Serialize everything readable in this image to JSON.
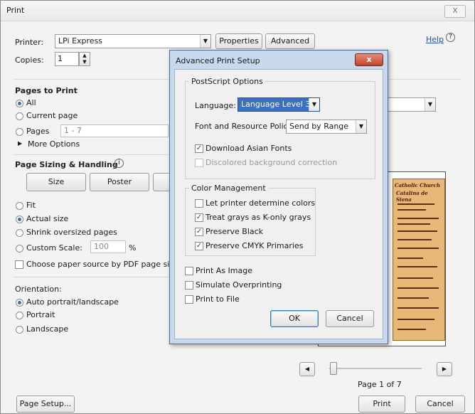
{
  "window": {
    "title": "Print",
    "close_label": "X"
  },
  "header": {
    "printer_label": "Printer:",
    "printer_value": "LPi Express",
    "properties_label": "Properties",
    "advanced_label": "Advanced",
    "help_label": "Help",
    "copies_label": "Copies:",
    "copies_value": "1"
  },
  "pages_to_print": {
    "heading": "Pages to Print",
    "all": "All",
    "current": "Current page",
    "pages": "Pages",
    "pages_value": "1 - 7",
    "more_options": "More Options"
  },
  "sizing": {
    "heading": "Page Sizing & Handling",
    "size_tab": "Size",
    "poster_tab": "Poster",
    "fit": "Fit",
    "actual": "Actual size",
    "shrink": "Shrink oversized pages",
    "custom": "Custom Scale:",
    "custom_value": "100",
    "percent": "%",
    "paper_source": "Choose paper source by PDF page size"
  },
  "orientation": {
    "heading": "Orientation:",
    "auto": "Auto portrait/landscape",
    "portrait": "Portrait",
    "landscape": "Landscape"
  },
  "preview": {
    "page_of": "Page 1 of 7",
    "title1": "Catholic Church",
    "title2": "Catalina de Siena"
  },
  "footer": {
    "page_setup": "Page Setup...",
    "print": "Print",
    "cancel": "Cancel"
  },
  "advanced_dialog": {
    "title": "Advanced Print Setup",
    "postscript_heading": "PostScript Options",
    "language_label": "Language:",
    "language_value": "Language Level 3",
    "font_policy_label": "Font and Resource Policy:",
    "font_policy_value": "Send by Range",
    "download_fonts": "Download Asian Fonts",
    "discolored": "Discolored background correction",
    "color_heading": "Color Management",
    "let_printer": "Let printer determine colors",
    "treat_grays": "Treat grays as K-only grays",
    "preserve_black": "Preserve Black",
    "preserve_cmyk": "Preserve CMYK Primaries",
    "print_as_image": "Print As Image",
    "simulate_overprint": "Simulate Overprinting",
    "print_to_file": "Print to File",
    "ok": "OK",
    "cancel": "Cancel"
  }
}
